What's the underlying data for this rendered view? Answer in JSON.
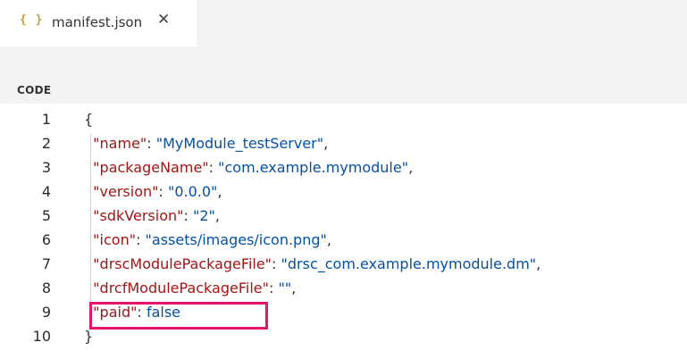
{
  "tab": {
    "icon_glyph": "{ }",
    "icon_name": "json-braces-icon",
    "label": "manifest.json",
    "close_glyph": "✕"
  },
  "section": {
    "title": "CODE"
  },
  "colors": {
    "key": "#a31515",
    "string": "#0451a5",
    "highlight": "#e4136b"
  },
  "editor": {
    "line_numbers": [
      "1",
      "2",
      "3",
      "4",
      "5",
      "6",
      "7",
      "8",
      "9",
      "10"
    ],
    "lines": [
      {
        "punct_open": "{"
      },
      {
        "key": "\"name\"",
        "sep": ": ",
        "value": "\"MyModule_testServer\"",
        "trail": ","
      },
      {
        "key": "\"packageName\"",
        "sep": ": ",
        "value": "\"com.example.mymodule\"",
        "trail": ","
      },
      {
        "key": "\"version\"",
        "sep": ": ",
        "value": "\"0.0.0\"",
        "trail": ","
      },
      {
        "key": "\"sdkVersion\"",
        "sep": ": ",
        "value": "\"2\"",
        "trail": ","
      },
      {
        "key": "\"icon\"",
        "sep": ": ",
        "value": "\"assets/images/icon.png\"",
        "trail": ","
      },
      {
        "key": "\"drscModulePackageFile\"",
        "sep": ": ",
        "value": "\"drsc_com.example.mymodule.dm\"",
        "trail": ","
      },
      {
        "key": "\"drcfModulePackageFile\"",
        "sep": ": ",
        "value": "\"\"",
        "trail": ","
      },
      {
        "key": "\"paid\"",
        "sep": ": ",
        "value": "false",
        "trail": ""
      },
      {
        "punct_close": "}"
      }
    ],
    "highlighted_line": "5"
  }
}
